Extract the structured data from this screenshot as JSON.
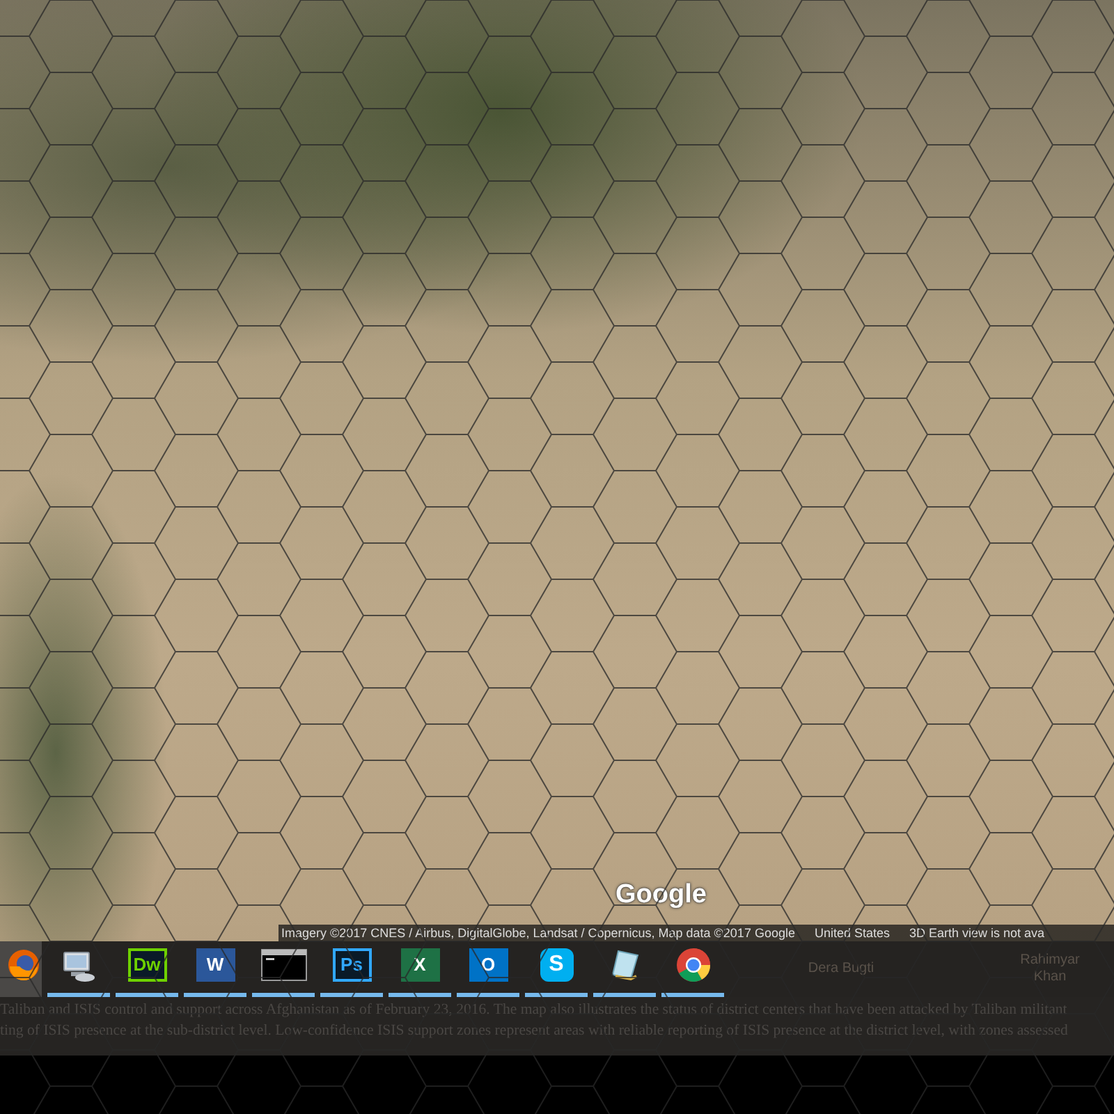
{
  "map": {
    "logo": "Google",
    "attribution": [
      "Imagery ©2017 CNES / Airbus, DigitalGlobe, Landsat / Copernicus, Map data ©2017 Google",
      "United States",
      "3D Earth view is not ava"
    ]
  },
  "taskbar": {
    "items": [
      {
        "kind": "firefox",
        "selected": true,
        "running": false
      },
      {
        "kind": "computer",
        "selected": false,
        "running": true
      },
      {
        "kind": "tile",
        "text": "Dw",
        "color": "#6ed100",
        "selected": false,
        "running": true
      },
      {
        "kind": "tile",
        "text": "W",
        "color": "#2b579a",
        "selected": false,
        "running": true
      },
      {
        "kind": "console",
        "selected": false,
        "running": true
      },
      {
        "kind": "tile",
        "text": "Ps",
        "color": "#31a8ff",
        "selected": false,
        "running": true
      },
      {
        "kind": "tile",
        "text": "X",
        "color": "#1e7145",
        "selected": false,
        "running": true
      },
      {
        "kind": "tile",
        "text": "O",
        "color": "#0072c6",
        "selected": false,
        "running": true
      },
      {
        "kind": "skype",
        "text": "S",
        "selected": false,
        "running": true
      },
      {
        "kind": "notepad",
        "selected": false,
        "running": true
      },
      {
        "kind": "chrome",
        "selected": false,
        "running": true
      }
    ],
    "map_labels": [
      "Dera Bugti",
      "Rahimyar Khan"
    ]
  },
  "document": {
    "lines": [
      "Taliban and ISIS control and support across Afghanistan as of February 23, 2016. The map also illustrates the status of district centers that have been attacked by Taliban militant",
      "ting of ISIS presence at the sub-district level. Low-confidence ISIS support zones represent areas with reliable reporting of ISIS presence at the district level, with zones assessed"
    ]
  }
}
